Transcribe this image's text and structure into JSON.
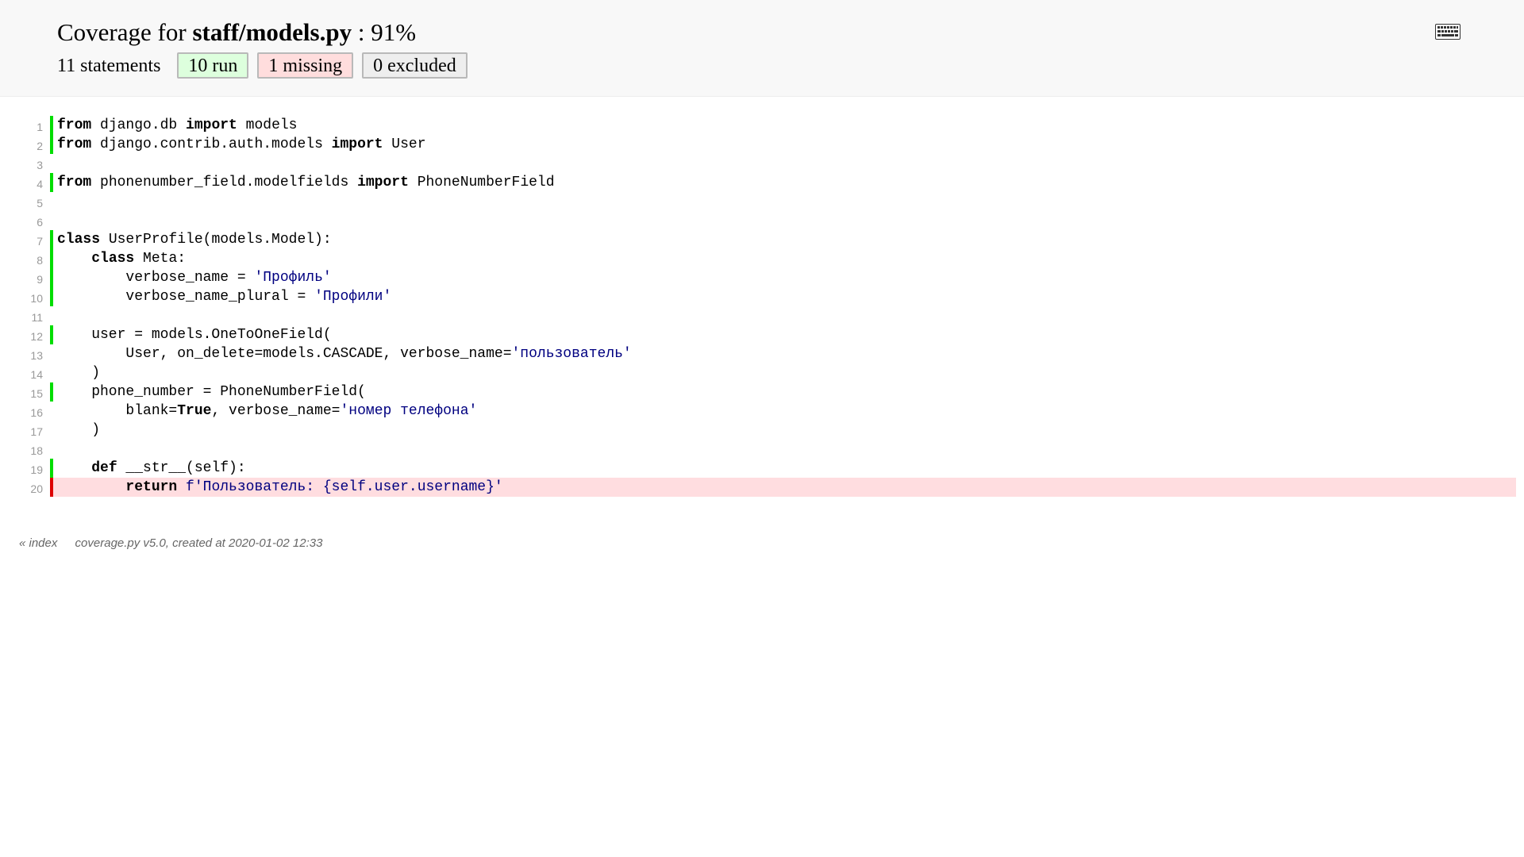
{
  "header": {
    "title_prefix": "Coverage for ",
    "file": "staff/models.py",
    "title_suffix": " : 91%",
    "statements": "11 statements",
    "run_button": "10 run",
    "missing_button": "1 missing",
    "excluded_button": "0 excluded",
    "keyboard_icon": "keyboard-icon"
  },
  "source": {
    "lines": [
      {
        "n": "1",
        "status": "run",
        "tokens": [
          [
            "k",
            "from"
          ],
          [
            "t",
            " django.db "
          ],
          [
            "k",
            "import"
          ],
          [
            "t",
            " models"
          ]
        ]
      },
      {
        "n": "2",
        "status": "run",
        "tokens": [
          [
            "k",
            "from"
          ],
          [
            "t",
            " django.contrib.auth.models "
          ],
          [
            "k",
            "import"
          ],
          [
            "t",
            " User"
          ]
        ]
      },
      {
        "n": "3",
        "status": "",
        "tokens": []
      },
      {
        "n": "4",
        "status": "run",
        "tokens": [
          [
            "k",
            "from"
          ],
          [
            "t",
            " phonenumber_field.modelfields "
          ],
          [
            "k",
            "import"
          ],
          [
            "t",
            " PhoneNumberField"
          ]
        ]
      },
      {
        "n": "5",
        "status": "",
        "tokens": []
      },
      {
        "n": "6",
        "status": "",
        "tokens": []
      },
      {
        "n": "7",
        "status": "run",
        "tokens": [
          [
            "k",
            "class"
          ],
          [
            "t",
            " UserProfile(models.Model):"
          ]
        ]
      },
      {
        "n": "8",
        "status": "run",
        "tokens": [
          [
            "t",
            "    "
          ],
          [
            "k",
            "class"
          ],
          [
            "t",
            " Meta:"
          ]
        ]
      },
      {
        "n": "9",
        "status": "run",
        "tokens": [
          [
            "t",
            "        verbose_name = "
          ],
          [
            "s",
            "'Профиль'"
          ]
        ]
      },
      {
        "n": "10",
        "status": "run",
        "tokens": [
          [
            "t",
            "        verbose_name_plural = "
          ],
          [
            "s",
            "'Профили'"
          ]
        ]
      },
      {
        "n": "11",
        "status": "",
        "tokens": []
      },
      {
        "n": "12",
        "status": "run",
        "tokens": [
          [
            "t",
            "    user = models.OneToOneField("
          ]
        ]
      },
      {
        "n": "13",
        "status": "",
        "tokens": [
          [
            "t",
            "        User, on_delete=models.CASCADE, verbose_name="
          ],
          [
            "s",
            "'пользователь'"
          ]
        ]
      },
      {
        "n": "14",
        "status": "",
        "tokens": [
          [
            "t",
            "    )"
          ]
        ]
      },
      {
        "n": "15",
        "status": "run",
        "tokens": [
          [
            "t",
            "    phone_number = PhoneNumberField("
          ]
        ]
      },
      {
        "n": "16",
        "status": "",
        "tokens": [
          [
            "t",
            "        blank="
          ],
          [
            "k",
            "True"
          ],
          [
            "t",
            ", verbose_name="
          ],
          [
            "s",
            "'номер телефона'"
          ]
        ]
      },
      {
        "n": "17",
        "status": "",
        "tokens": [
          [
            "t",
            "    )"
          ]
        ]
      },
      {
        "n": "18",
        "status": "",
        "tokens": []
      },
      {
        "n": "19",
        "status": "run",
        "tokens": [
          [
            "t",
            "    "
          ],
          [
            "k",
            "def"
          ],
          [
            "t",
            " __str__(self):"
          ]
        ]
      },
      {
        "n": "20",
        "status": "mis",
        "tokens": [
          [
            "t",
            "        "
          ],
          [
            "k",
            "return"
          ],
          [
            "t",
            " "
          ],
          [
            "s",
            "f'Пользователь: {self.user.username}'"
          ]
        ]
      }
    ]
  },
  "footer": {
    "index_link": "« index",
    "created": "coverage.py v5.0, created at 2020-01-02 12:33"
  },
  "colors": {
    "run": "#00dd00",
    "missing": "#dd0000",
    "missing_bg": "#ffdde0",
    "string": "#000080"
  }
}
